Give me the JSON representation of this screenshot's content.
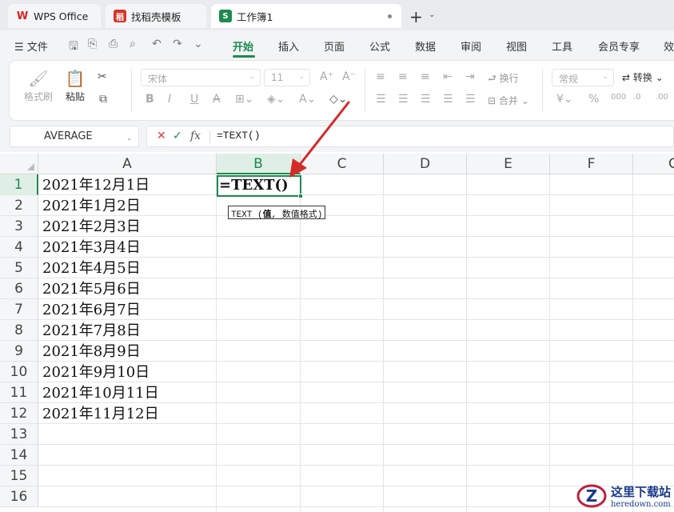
{
  "tabs": {
    "wps": "WPS Office",
    "template": "找稻壳模板",
    "workbook": "工作簿1"
  },
  "menu": {
    "file": "文件",
    "items": [
      "开始",
      "插入",
      "页面",
      "公式",
      "数据",
      "审阅",
      "视图",
      "工具",
      "会员专享",
      "效"
    ],
    "active": "开始"
  },
  "ribbon": {
    "format_painter": "格式刷",
    "paste": "粘贴",
    "font_name": "宋体",
    "font_size": "11",
    "wrap": "换行",
    "merge": "合并",
    "number_format": "常规",
    "convert": "转换"
  },
  "formula_bar": {
    "name_box": "AVERAGE",
    "fx": "fx",
    "formula": "=TEXT()"
  },
  "columns": [
    "A",
    "B",
    "C",
    "D",
    "E",
    "F",
    "G"
  ],
  "rows": [
    "1",
    "2",
    "3",
    "4",
    "5",
    "6",
    "7",
    "8",
    "9",
    "10",
    "11",
    "12",
    "13",
    "14",
    "15",
    "16"
  ],
  "cells_a": [
    "2021年12月1日",
    "2021年1月2日",
    "2021年2月3日",
    "2021年3月4日",
    "2021年4月5日",
    "2021年5月6日",
    "2021年6月7日",
    "2021年7月8日",
    "2021年8月9日",
    "2021年9月10日",
    "2021年10月11日",
    "2021年11月12日"
  ],
  "active_cell": {
    "content": "=TEXT()"
  },
  "tooltip": {
    "func": "TEXT (",
    "arg_bold": "值",
    "rest": ", 数值格式)"
  },
  "watermark": {
    "cn": "这里下载站",
    "en": "heredown.com"
  },
  "colors": {
    "accent": "#1d8a4e",
    "arrow": "#d42a2a"
  }
}
